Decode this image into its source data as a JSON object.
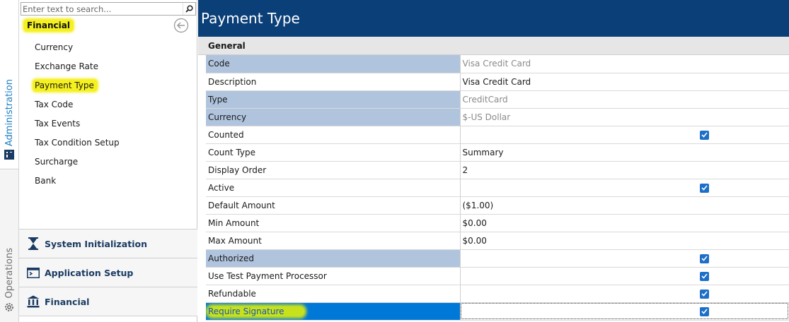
{
  "rail": {
    "admin_label": "Administration",
    "ops_label": "Operations"
  },
  "sidebar": {
    "search_placeholder": "Enter text to search...",
    "section_title": "Financial",
    "items": [
      {
        "label": "Currency"
      },
      {
        "label": "Exchange Rate"
      },
      {
        "label": "Payment Type",
        "active": true
      },
      {
        "label": "Tax Code"
      },
      {
        "label": "Tax Events"
      },
      {
        "label": "Tax Condition Setup"
      },
      {
        "label": "Surcharge"
      },
      {
        "label": "Bank"
      }
    ],
    "groups": [
      {
        "label": "System Initialization",
        "icon": "hourglass-icon"
      },
      {
        "label": "Application Setup",
        "icon": "console-icon"
      },
      {
        "label": "Financial",
        "icon": "bank-icon"
      }
    ]
  },
  "main": {
    "title": "Payment Type",
    "group_label": "General",
    "properties": [
      {
        "name": "Code",
        "value": "Visa Credit Card",
        "readonly": true
      },
      {
        "name": "Description",
        "value": "Visa Credit Card"
      },
      {
        "name": "Type",
        "value": "CreditCard",
        "readonly": true
      },
      {
        "name": "Currency",
        "value": "$-US Dollar",
        "readonly": true
      },
      {
        "name": "Counted",
        "checked": true
      },
      {
        "name": "Count Type",
        "value": "Summary"
      },
      {
        "name": "Display Order",
        "value": "2"
      },
      {
        "name": "Active",
        "checked": true
      },
      {
        "name": "Default Amount",
        "value": "($1.00)"
      },
      {
        "name": "Min Amount",
        "value": "$0.00"
      },
      {
        "name": "Max Amount",
        "value": "$0.00"
      },
      {
        "name": "Authorized",
        "checked": true,
        "readonly": true
      },
      {
        "name": "Use Test Payment Processor",
        "checked": true
      },
      {
        "name": "Refundable",
        "checked": true
      },
      {
        "name": "Require Signature",
        "checked": true,
        "selected": true
      }
    ]
  },
  "colors": {
    "header_bg": "#0b3f78",
    "highlight": "#f5f01e",
    "readonly_label_bg": "#b0c4de",
    "selected_row_bg": "#0078d7",
    "checkbox": "#1d6fc8"
  }
}
